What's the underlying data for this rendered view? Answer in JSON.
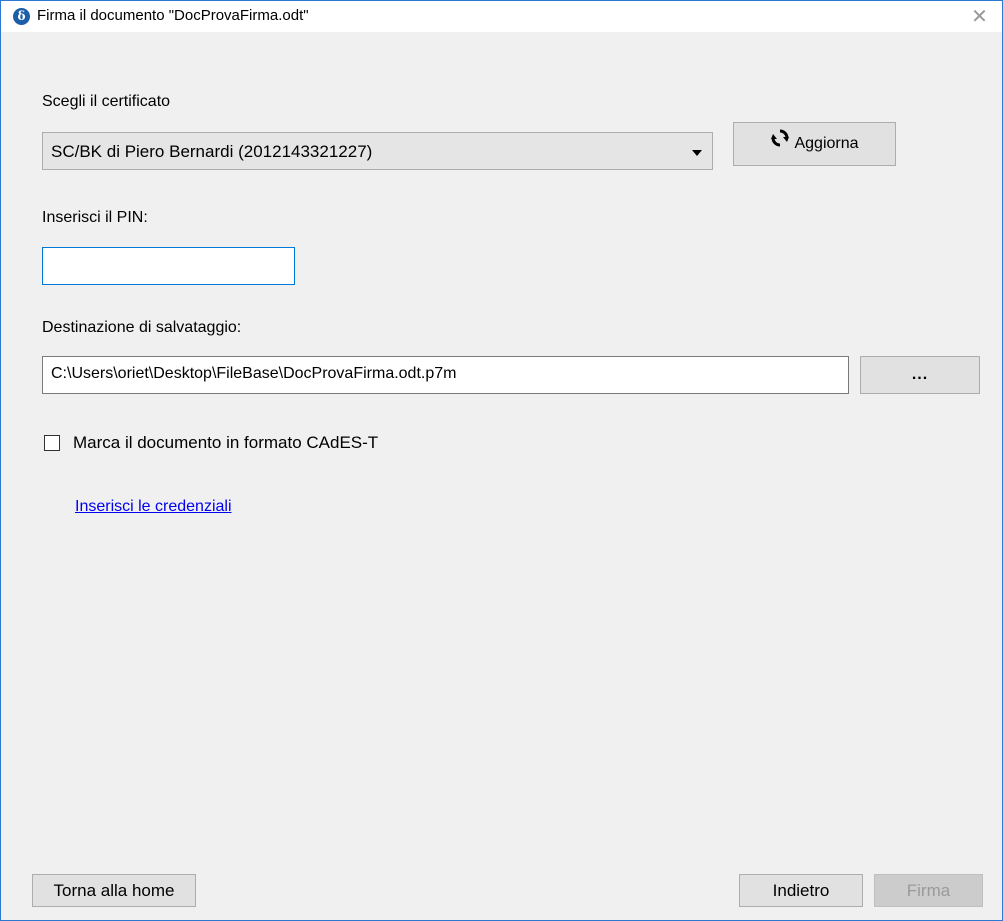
{
  "window": {
    "title": "Firma il documento \"DocProvaFirma.odt\"",
    "app_icon_glyph": "δ",
    "close_glyph": "✕"
  },
  "certificate": {
    "label": "Scegli il certificato",
    "selected": "SC/BK di Piero Bernardi (2012143321227)",
    "refresh_label": "Aggiorna"
  },
  "pin": {
    "label": "Inserisci il PIN:",
    "value": ""
  },
  "destination": {
    "label": "Destinazione di salvataggio:",
    "path": "C:\\Users\\oriet\\Desktop\\FileBase\\DocProvaFirma.odt.p7m",
    "browse_label": "..."
  },
  "cades": {
    "label": "Marca il documento in formato CAdES-T",
    "checked": false
  },
  "credentials_link": "Inserisci le credenziali",
  "footer": {
    "home_label": "Torna alla home",
    "back_label": "Indietro",
    "sign_label": "Firma"
  },
  "colors": {
    "accent": "#0078d7",
    "window_border": "#2b79d3",
    "link": "#0000ee",
    "disabled_text": "#9a9a9a"
  }
}
